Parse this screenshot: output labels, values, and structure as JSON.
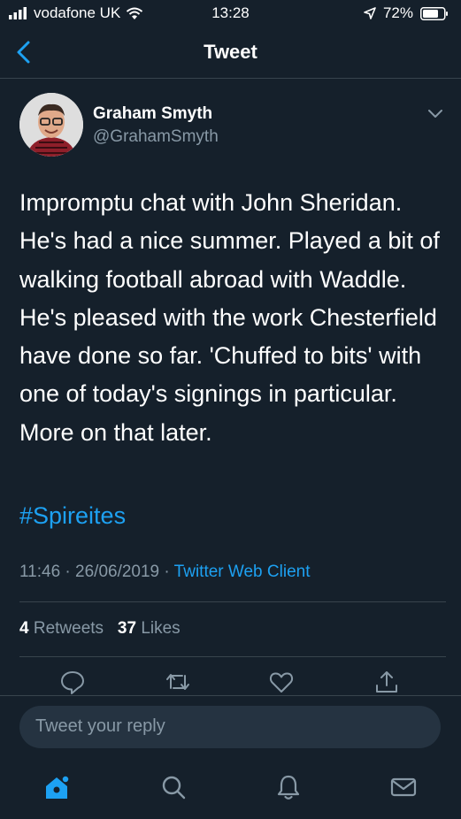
{
  "status_bar": {
    "carrier": "vodafone UK",
    "time": "13:28",
    "battery": "72%",
    "icons": [
      "signal-icon",
      "wifi-icon",
      "location-arrow-icon",
      "battery-icon"
    ]
  },
  "nav": {
    "title": "Tweet",
    "back_icon": "back-chevron-icon"
  },
  "tweet": {
    "author_name": "Graham Smyth",
    "author_handle": "@GrahamSmyth",
    "text": "Impromptu chat with John Sheridan. He's had a nice summer. Played a bit of walking football abroad with Waddle. He's pleased with the work Chesterfield have done so far. 'Chuffed to bits' with one of today's signings in particular. More on that later.",
    "hashtag": "#Spireites",
    "time": "11:46",
    "date": "26/06/2019",
    "separator": "·",
    "client": "Twitter Web Client",
    "retweets_count": "4",
    "retweets_label": "Retweets",
    "likes_count": "37",
    "likes_label": "Likes"
  },
  "actions": [
    "reply-icon",
    "retweet-icon",
    "like-icon",
    "share-icon"
  ],
  "reply": {
    "placeholder": "Tweet your reply"
  },
  "tabbar": [
    "home-icon",
    "search-icon",
    "notifications-icon",
    "messages-icon"
  ],
  "colors": {
    "background": "#15202b",
    "accent": "#1da1f2",
    "muted": "#8899a6",
    "divider": "#38444d"
  }
}
